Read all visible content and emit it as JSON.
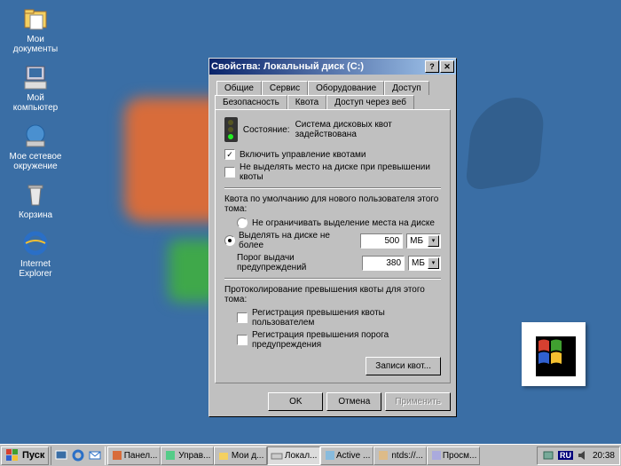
{
  "desktop": {
    "icons": [
      {
        "label": "Мои\nдокументы",
        "name": "my-documents"
      },
      {
        "label": "Мой\nкомпьютер",
        "name": "my-computer"
      },
      {
        "label": "Мое сетевое\nокружение",
        "name": "network"
      },
      {
        "label": "Корзина",
        "name": "recycle-bin"
      },
      {
        "label": "Internet\nExplorer",
        "name": "ie"
      }
    ]
  },
  "dialog": {
    "title": "Свойства: Локальный диск (C:)",
    "tabs_row1": [
      "Общие",
      "Сервис",
      "Оборудование",
      "Доступ"
    ],
    "tabs_row2": [
      "Безопасность",
      "Квота",
      "Доступ через веб"
    ],
    "active_tab": "Квота",
    "status_label": "Состояние:",
    "status_text": "Система дисковых квот задействована",
    "chk_enable": "Включить управление квотами",
    "chk_deny": "Не выделять место на диске при превышении квоты",
    "default_label": "Квота по умолчанию для нового пользователя этого тома:",
    "rad_unlimited": "Не ограничивать выделение места на диске",
    "rad_limit": "Выделять на диске не более",
    "warn_label": "Порог выдачи предупреждений",
    "limit_value": "500",
    "limit_unit": "МБ",
    "warn_value": "380",
    "warn_unit": "МБ",
    "log_label": "Протоколирование превышения квоты для этого тома:",
    "chk_log_user": "Регистрация превышения квоты пользователем",
    "chk_log_warn": "Регистрация превышения порога предупреждения",
    "quota_entries_btn": "Записи квот...",
    "ok": "OK",
    "cancel": "Отмена",
    "apply": "Применить"
  },
  "taskbar": {
    "start": "Пуск",
    "tasks": [
      {
        "label": "Панел...",
        "active": false
      },
      {
        "label": "Управ...",
        "active": false
      },
      {
        "label": "Мои д...",
        "active": false
      },
      {
        "label": "Локал...",
        "active": true
      },
      {
        "label": "Active ...",
        "active": false
      },
      {
        "label": "ntds://...",
        "active": false
      },
      {
        "label": "Просм...",
        "active": false
      }
    ],
    "lang": "RU",
    "clock": "20:38"
  }
}
